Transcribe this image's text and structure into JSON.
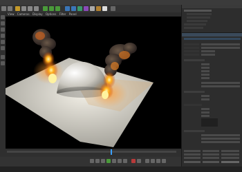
{
  "menubar": {
    "items": [
      "",
      "",
      "",
      "",
      "",
      "",
      "",
      ""
    ]
  },
  "viewport": {
    "menu": [
      "View",
      "Cameras",
      "Display",
      "Options",
      "Filter",
      "Panel"
    ]
  },
  "accent": "#c8a020",
  "scene": {
    "render": "fire-smoke-plume-on-sphere"
  }
}
